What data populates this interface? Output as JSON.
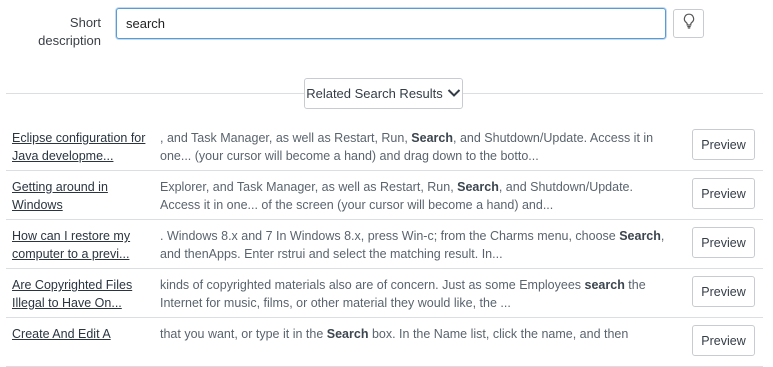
{
  "form": {
    "short_description_label": "Short description",
    "short_description_value": "search",
    "hint_icon": "lightbulb-icon"
  },
  "related": {
    "button_label": "Related Search Results",
    "chevron_icon": "chevron-down-icon"
  },
  "results": [
    {
      "title": "Eclipse configuration for Java developme...",
      "snippet_before": ", and Task Manager, as well as Restart, Run, ",
      "snippet_match": "Search",
      "snippet_after": ", and Shutdown/Update. Access it in one... (your cursor will become a hand) and drag down to the botto...",
      "preview_label": "Preview"
    },
    {
      "title": "Getting around in Windows",
      "snippet_before": "Explorer, and Task Manager, as well as Restart, Run, ",
      "snippet_match": "Search",
      "snippet_after": ", and Shutdown/Update. Access it in one... of the screen (your cursor will become a hand) and...",
      "preview_label": "Preview"
    },
    {
      "title": "How can I restore my computer to a previ...",
      "snippet_before": ". Windows 8.x and 7 In Windows 8.x, press Win-c; from the Charms menu, choose ",
      "snippet_match": "Search",
      "snippet_after": ", and thenApps. Enter rstrui and select the matching result.      In...",
      "preview_label": "Preview"
    },
    {
      "title": "Are Copyrighted Files Illegal to Have On...",
      "snippet_before": "kinds of copyrighted materials also are of concern. Just as some Employees ",
      "snippet_match": "search",
      "snippet_after": " the Internet for music, films, or other material they would like, the ...",
      "preview_label": "Preview"
    },
    {
      "title": "Create And Edit A",
      "snippet_before": "that you want, or type it in the ",
      "snippet_match": "Search",
      "snippet_after": " box. In the Name list, click the name, and then",
      "preview_label": "Preview"
    }
  ]
}
